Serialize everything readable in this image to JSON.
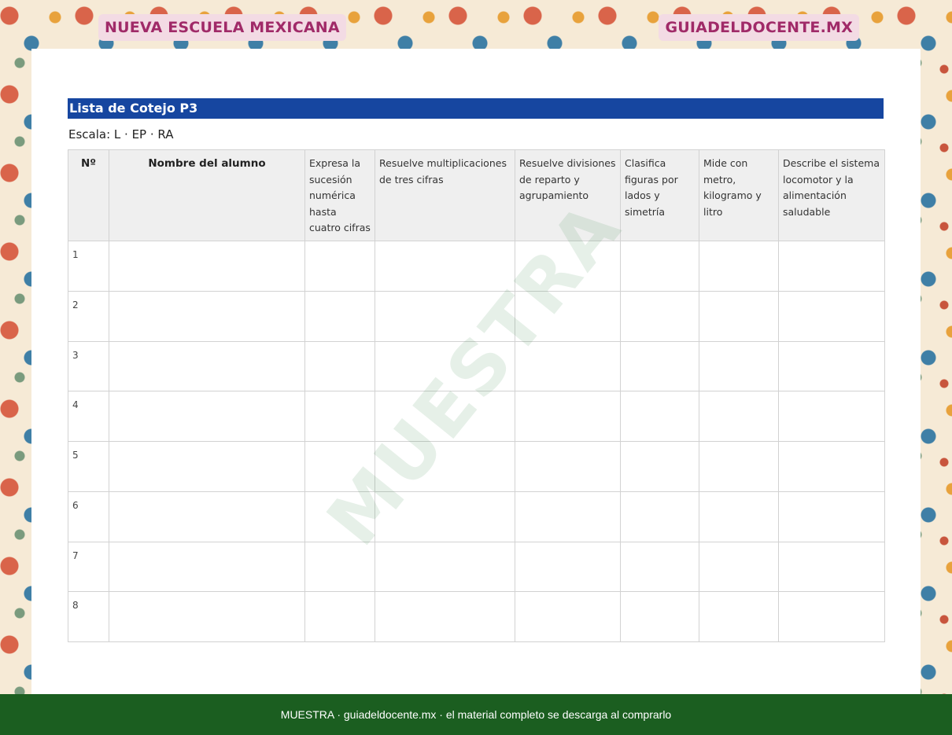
{
  "header": {
    "left_label": "NUEVA ESCUELA MEXICANA",
    "right_label": "GUIADELDOCENTE.MX"
  },
  "document": {
    "title": "Lista de Cotejo P3",
    "scale": "Escala: L · EP · RA",
    "watermark": "MUESTRA"
  },
  "table": {
    "columns": [
      "Nº",
      "Nombre del alumno",
      "Expresa la sucesión numérica hasta cuatro cifras",
      "Resuelve multiplicaciones de tres cifras",
      "Resuelve divisiones de reparto y agrupamiento",
      "Clasifica figuras por lados y simetría",
      "Mide con metro, kilogramo y litro",
      "Describe el sistema locomotor y la alimentación saludable"
    ],
    "rows": [
      "1",
      "2",
      "3",
      "4",
      "5",
      "6",
      "7",
      "8"
    ]
  },
  "footer": {
    "text": "MUESTRA · guiadeldocente.mx · el material completo se descarga al comprarlo"
  }
}
